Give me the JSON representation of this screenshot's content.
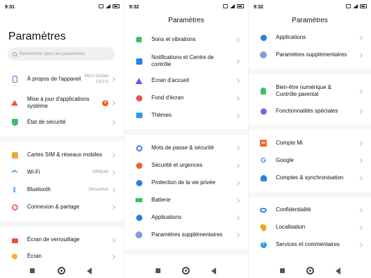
{
  "panel1": {
    "time": "9:31",
    "title": "Paramètres",
    "search_placeholder": "Rechercher dans les paramètres",
    "items": [
      {
        "label": "À propos de l'appareil",
        "value": "MIUI Global 13.0.6"
      },
      {
        "label": "Mise à jour d'applications système",
        "badge": "8"
      },
      {
        "label": "État de sécurité"
      },
      {
        "label": "Cartes SIM & réseaux mobiles"
      },
      {
        "label": "Wi-Fi",
        "value": "ORBI49"
      },
      {
        "label": "Bluetooth",
        "value": "Désactivé"
      },
      {
        "label": "Connexion & partage"
      },
      {
        "label": "Écran de verrouillage"
      },
      {
        "label": "Écran"
      }
    ]
  },
  "panel2": {
    "time": "9:32",
    "title": "Paramètres",
    "items": [
      {
        "label": "Sons et vibrations"
      },
      {
        "label": "Notifications et Centre de contrôle"
      },
      {
        "label": "Écran d'accueil"
      },
      {
        "label": "Fond d'écran"
      },
      {
        "label": "Thèmes"
      },
      {
        "label": "Mots de passe & sécurité"
      },
      {
        "label": "Sécurité et urgences"
      },
      {
        "label": "Protection de la vie privée"
      },
      {
        "label": "Batterie"
      },
      {
        "label": "Applications"
      },
      {
        "label": "Paramètres supplémentaires"
      }
    ]
  },
  "panel3": {
    "time": "9:32",
    "title": "Paramètres",
    "items": [
      {
        "label": "Applications"
      },
      {
        "label": "Paramètres supplémentaires"
      },
      {
        "label": "Bien-être numérique & Contrôle parental"
      },
      {
        "label": "Fonctionnalités spéciales"
      },
      {
        "label": "Compte Mi"
      },
      {
        "label": "Google"
      },
      {
        "label": "Comptes & synchronisation"
      },
      {
        "label": "Confidentialité"
      },
      {
        "label": "Localisation"
      },
      {
        "label": "Services et commentaires"
      }
    ]
  },
  "icons": {
    "mi_text": "mi",
    "google_text": "G",
    "help_text": "?",
    "bt_text": "ᛒ"
  }
}
